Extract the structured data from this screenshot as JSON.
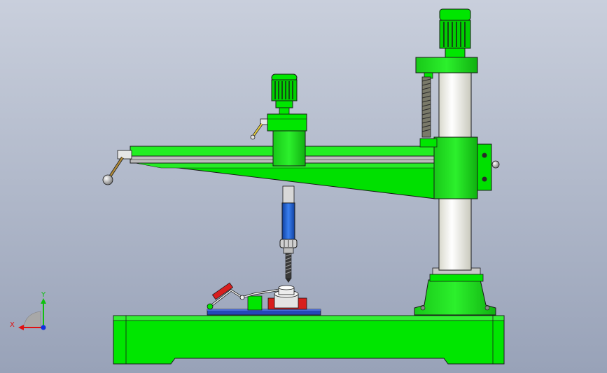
{
  "view": {
    "background_top": "#c9cfdc",
    "background_bottom": "#98a2b8"
  },
  "model": {
    "primary_color": "#00e600",
    "outline_color": "#1a1a1a",
    "column_color": "#f4f4ec",
    "spindle_color": "#1f5fd0",
    "table_color": "#2448b8",
    "clamp_accent": "#d81e1e",
    "handle_color": "#b08a3a"
  },
  "triad": {
    "x_label": "X",
    "y_label": "Y",
    "x_color": "#e01010",
    "y_color": "#10c010",
    "z_color": "#1030e0"
  }
}
